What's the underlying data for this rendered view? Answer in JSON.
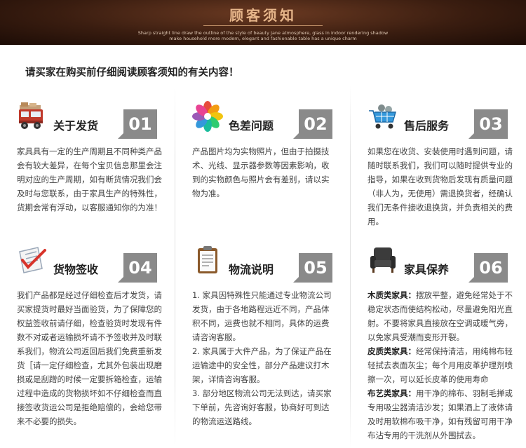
{
  "banner": {
    "title": "顾客须知",
    "subtitle": "Sharp straight line draw the outline of the style of beauty Jane atmosphere, glass in indoor rendering shadow make household more modern, elegant and fashionable table has a unique charm"
  },
  "intro": "请买家在购买前仔细阅读顾客须知的有关内容！",
  "cards": [
    {
      "number": "01",
      "title": "关于发货",
      "icon": "delivery-truck-icon",
      "paragraphs": [
        "家具具有一定的生产周期且不同种类产品会有较大差异，在每个宝贝信息那里会注明对应的生产周期，如有断货情况我们会及时与您联系，由于家具生产的特殊性，货期会常有浮动，以客服通知你的为准！"
      ]
    },
    {
      "number": "02",
      "title": "色差问题",
      "icon": "color-palette-icon",
      "paragraphs": [
        "产品图片均为实物照片，但由于拍摄技术、光线、显示器参数等因素影响，收到的实物颜色与照片会有差别，请以实物为准。"
      ]
    },
    {
      "number": "03",
      "title": "售后服务",
      "icon": "shopping-cart-icon",
      "paragraphs": [
        "如果您在收货、安装使用时遇到问题，请随时联系我们，我们可以随时提供专业的指导，如果在收到货物后发现有质量问题（非人为，无使用）需退换货者，经确认我们无条件接收退换货，并负责相关的费用。"
      ]
    },
    {
      "number": "04",
      "title": "货物签收",
      "icon": "checklist-icon",
      "paragraphs": [
        "我们产品都是经过仔细检查后才发货，请买家提货时最好当面验货，为了保障您的权益签收前请仔细，检查验货时发现有件数不对或者运输损坏请不予签收并及时联系我们，物流公司返回后我们免费重新发货［请一定仔细检查，尤其外包装出现磨损或是刮蹭的时候一定要拆箱检查，运输过程中造成的货物损坏如不仔细检查而直接签收货运公司是拒绝赔偿的，会给您带来不必要的损失。"
      ]
    },
    {
      "number": "05",
      "title": "物流说明",
      "icon": "clipboard-icon",
      "paragraphs": [
        "1. 家具因特殊性只能通过专业物流公司发货，由于各地路程远近不同，产品体积不同，运费也就不相同，具体的运费请咨询客服。",
        "2. 家具属于大件产品，为了保证产品在运输途中的安全性，部分产品建议打木架，详情咨询客服。",
        "3. 部分地区物流公司无法到达，请买家下单前，先咨询好客服，协商好可到达的物流运送路线。"
      ]
    },
    {
      "number": "06",
      "title": "家具保养",
      "icon": "armchair-icon",
      "sections": [
        {
          "label": "木质类家具：",
          "text": "摆放平整，避免经常处于不稳定状态而使结构松动，尽量避免阳光直射。不要将家具直接放在空调或暖气旁，以免家具受潮而变形开裂。"
        },
        {
          "label": "皮质类家具：",
          "text": "经常保持清洁，用纯棉布轻轻拭去表面灰尘；每个月用皮革护理剂喷擦一次，可以延长皮革的使用寿命"
        },
        {
          "label": "布艺类家具：",
          "text": "用干净的棉布、羽制毛掸或专用吸尘器清洁沙发；如果洒上了液体请及时用软棉布吸干净，如有残留可用干净布沾专用的干洗剂从外围拭去。"
        }
      ]
    }
  ]
}
